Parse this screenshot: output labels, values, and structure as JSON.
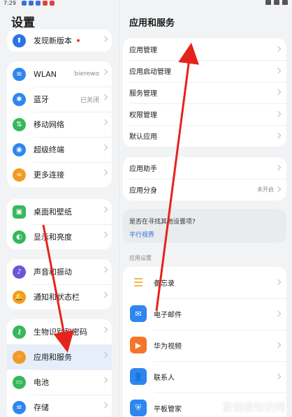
{
  "statusbar": {
    "time": "7:29"
  },
  "left": {
    "title": "设置",
    "groups": [
      [
        {
          "label": "发现新版本",
          "icon": "update-icon",
          "color": "#2b73e8"
        }
      ],
      [
        {
          "label": "WLAN",
          "value": "bierewo",
          "icon": "wifi-icon",
          "color": "#2e86f0"
        },
        {
          "label": "蓝牙",
          "value": "已关闭",
          "icon": "bluetooth-icon",
          "color": "#2e86f0"
        },
        {
          "label": "移动网络",
          "icon": "mobile-network-icon",
          "color": "#35b85a"
        },
        {
          "label": "超级终端",
          "icon": "super-device-icon",
          "color": "#2e86f0"
        },
        {
          "label": "更多连接",
          "icon": "more-connections-icon",
          "color": "#f29b24"
        }
      ],
      [
        {
          "label": "桌面和壁纸",
          "icon": "wallpaper-icon",
          "color": "#35b85a"
        },
        {
          "label": "显示和亮度",
          "icon": "display-icon",
          "color": "#35b85a"
        }
      ],
      [
        {
          "label": "声音和振动",
          "icon": "sound-icon",
          "color": "#6a56d8"
        },
        {
          "label": "通知和状态栏",
          "icon": "notification-icon",
          "color": "#f29b24"
        }
      ],
      [
        {
          "label": "生物识别和密码",
          "icon": "biometrics-icon",
          "color": "#35b85a"
        },
        {
          "label": "应用和服务",
          "icon": "apps-icon",
          "color": "#f29b24"
        },
        {
          "label": "电池",
          "icon": "battery-icon",
          "color": "#35b85a"
        },
        {
          "label": "存储",
          "icon": "storage-icon",
          "color": "#2e86f0"
        }
      ]
    ]
  },
  "right": {
    "title": "应用和服务",
    "group1": [
      "应用管理",
      "应用启动管理",
      "服务管理",
      "权限管理",
      "默认应用"
    ],
    "group2": [
      {
        "label": "应用助手"
      },
      {
        "label": "应用分身",
        "value": "未开启"
      }
    ],
    "suggest": {
      "question": "是否在寻找其他设置项?",
      "link": "平行视界"
    },
    "section_label": "应用设置",
    "apps": [
      {
        "label": "备忘录",
        "icon": "memo-icon",
        "color": "#f5a623"
      },
      {
        "label": "电子邮件",
        "icon": "email-icon",
        "color": "#2e86f0"
      },
      {
        "label": "华为视频",
        "icon": "video-icon",
        "color": "#f5762a"
      },
      {
        "label": "联系人",
        "icon": "contacts-icon",
        "color": "#2e86f0"
      },
      {
        "label": "平板管家",
        "icon": "tablet-manager-icon",
        "color": "#2e86f0"
      }
    ]
  },
  "watermark": "爱创根知识网",
  "colors": {
    "arrow": "#e5231b",
    "link": "#2f6fd8",
    "selected_bg": "#e6eefb"
  }
}
